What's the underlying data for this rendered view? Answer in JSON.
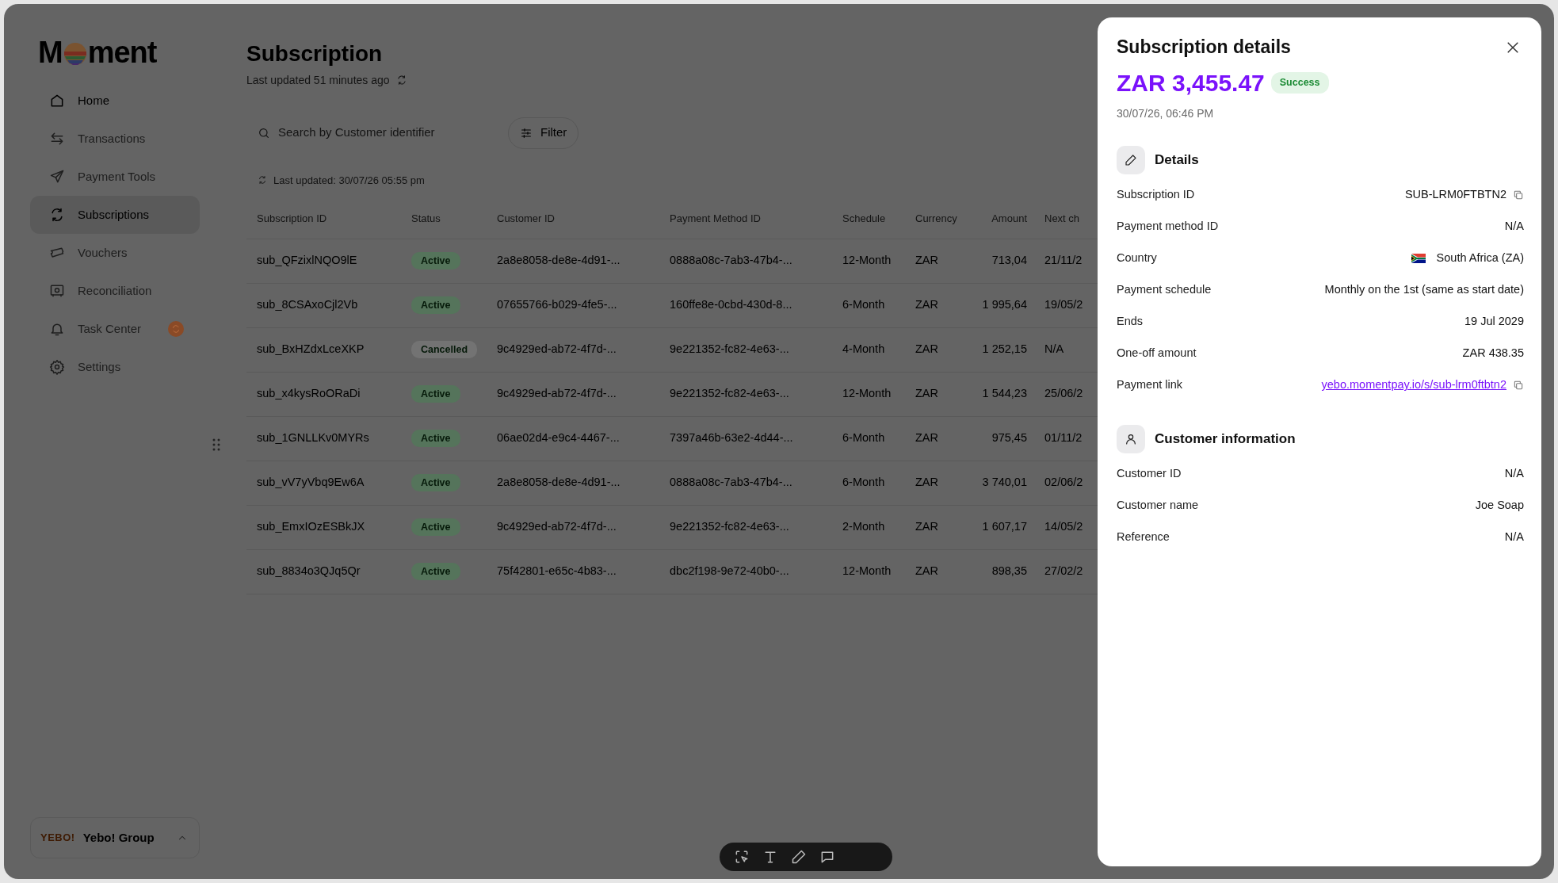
{
  "sidebar": {
    "logo": {
      "before": "M",
      "after": "ment"
    },
    "items": [
      {
        "label": "Home",
        "kind": "home",
        "selected": false,
        "disabled": false,
        "alert": false
      },
      {
        "label": "Transactions",
        "kind": "transactions",
        "selected": false,
        "disabled": true,
        "alert": false
      },
      {
        "label": "Payment Tools",
        "kind": "send",
        "selected": false,
        "disabled": true,
        "alert": false
      },
      {
        "label": "Subscriptions",
        "kind": "subscriptions",
        "selected": true,
        "disabled": false,
        "alert": false
      },
      {
        "label": "Vouchers",
        "kind": "ticket",
        "selected": false,
        "disabled": true,
        "alert": false
      },
      {
        "label": "Reconciliation",
        "kind": "safe",
        "selected": false,
        "disabled": true,
        "alert": false
      },
      {
        "label": "Task Center",
        "kind": "bell",
        "selected": false,
        "disabled": true,
        "alert": true
      },
      {
        "label": "Settings",
        "kind": "settings",
        "selected": false,
        "disabled": true,
        "alert": false
      }
    ],
    "org": {
      "logo_text": "YEBO!",
      "name": "Yebo! Group"
    }
  },
  "page": {
    "title": "Subscription",
    "updated": "Last updated 51 minutes ago"
  },
  "search": {
    "placeholder": "Search by Customer identifier"
  },
  "filter_button": "Filter",
  "table_updated": "Last updated: 30/07/26 05:55 pm",
  "table": {
    "columns": [
      "Subscription ID",
      "Status",
      "Customer ID",
      "Payment Method ID",
      "Schedule",
      "Currency",
      "Amount",
      "Next ch"
    ],
    "rows": [
      {
        "cells": [
          "sub_QFzixlNQO9lE",
          "Active",
          "2a8e8058-de8e-4d91-...",
          "0888a08c-7ab3-47b4-...",
          "12-Month",
          "ZAR",
          "713,04",
          "21/11/2"
        ],
        "color": "#55745b"
      },
      {
        "cells": [
          "sub_8CSAxoCjl2Vb",
          "Active",
          "07655766-b029-4fe5-...",
          "160ffe8e-0cbd-430d-8...",
          "6-Month",
          "ZAR",
          "1 995,64",
          "19/05/2"
        ],
        "color": "#55745b"
      },
      {
        "cells": [
          "sub_BxHZdxLceXKP",
          "Cancelled",
          "9c4929ed-ab72-4f7d-...",
          "9e221352-fc82-4e63-...",
          "4-Month",
          "ZAR",
          "1 252,15",
          "N/A"
        ],
        "color": "#737373"
      },
      {
        "cells": [
          "sub_x4kysRoORaDi",
          "Active",
          "9c4929ed-ab72-4f7d-...",
          "9e221352-fc82-4e63-...",
          "12-Month",
          "ZAR",
          "1 544,23",
          "25/06/2"
        ],
        "color": "#55745b"
      },
      {
        "cells": [
          "sub_1GNLLKv0MYRs",
          "Active",
          "06ae02d4-e9c4-4467-...",
          "7397a46b-63e2-4d44-...",
          "6-Month",
          "ZAR",
          "975,45",
          "01/11/2"
        ],
        "color": "#55745b"
      },
      {
        "cells": [
          "sub_vV7yVbq9Ew6A",
          "Active",
          "2a8e8058-de8e-4d91-...",
          "0888a08c-7ab3-47b4-...",
          "6-Month",
          "ZAR",
          "3 740,01",
          "02/06/2"
        ],
        "color": "#55745b"
      },
      {
        "cells": [
          "sub_EmxIOzESBkJX",
          "Active",
          "9c4929ed-ab72-4f7d-...",
          "9e221352-fc82-4e63-...",
          "2-Month",
          "ZAR",
          "1 607,17",
          "14/05/2"
        ],
        "color": "#55745b"
      },
      {
        "cells": [
          "sub_8834o3QJq5Qr",
          "Active",
          "75f42801-e65c-4b83-...",
          "dbc2f198-9e72-40b0-...",
          "12-Month",
          "ZAR",
          "898,35",
          "27/02/2"
        ],
        "color": "#55745b"
      }
    ]
  },
  "drawer": {
    "title": "Subscription details",
    "amount": "ZAR 3,455.47",
    "status": "Success",
    "date": "30/07/26, 06:46 PM",
    "sections": [
      {
        "kind": "details",
        "title": "Details",
        "rows": [
          {
            "label": "Subscription ID",
            "value": "SUB-LRM0FTBTN2",
            "kind": "text",
            "copyable": true
          },
          {
            "label": "Payment method ID",
            "value": "N/A",
            "kind": "text",
            "copyable": false
          },
          {
            "label": "Country",
            "value": "South Africa (ZA)",
            "kind": "country",
            "copyable": false
          },
          {
            "label": "Payment schedule",
            "value": "Monthly on the 1st (same as start date)",
            "kind": "text",
            "copyable": false
          },
          {
            "label": "Ends",
            "value": "19 Jul 2029",
            "kind": "text",
            "copyable": false
          },
          {
            "label": "One-off amount",
            "value": "ZAR 438.35",
            "kind": "text",
            "copyable": false
          },
          {
            "label": "Payment link",
            "value": "yebo.momentpay.io/s/sub-lrm0ftbtn2",
            "kind": "link",
            "copyable": true
          }
        ]
      },
      {
        "kind": "customer",
        "title": "Customer information",
        "rows": [
          {
            "label": "Customer ID",
            "value": "N/A",
            "kind": "text",
            "copyable": false
          },
          {
            "label": "Customer name",
            "value": "Joe Soap",
            "kind": "text",
            "copyable": false
          },
          {
            "label": "Reference",
            "value": "N/A",
            "kind": "text",
            "copyable": false
          }
        ]
      }
    ]
  }
}
